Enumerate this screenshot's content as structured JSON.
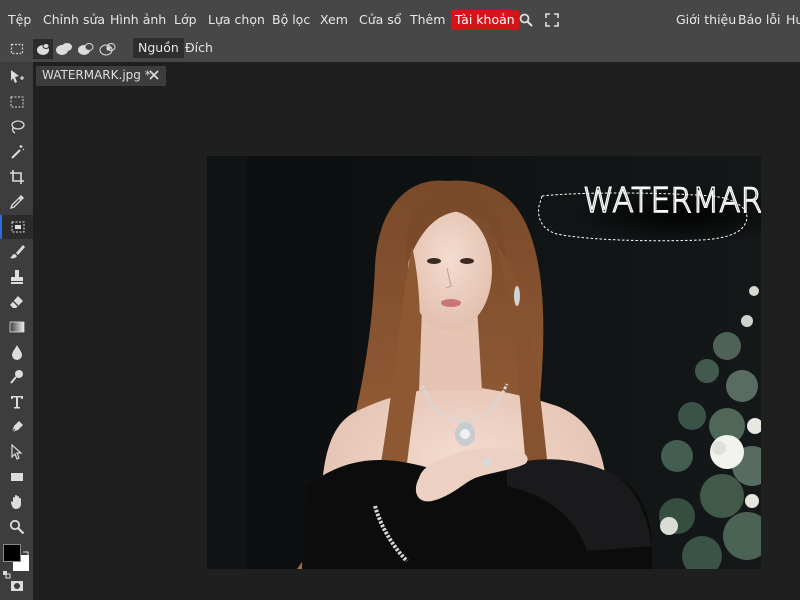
{
  "menu": {
    "items": [
      "Tệp",
      "Chỉnh sửa",
      "Hình ảnh",
      "Lớp",
      "Lựa chọn",
      "Bộ lọc",
      "Xem",
      "Cửa sổ",
      "Thêm",
      "Tài khoản"
    ],
    "right_items": [
      "Giới thiệu",
      "Báo lỗi",
      "Hu"
    ],
    "search_icon": "search-icon",
    "fullscreen_icon": "fullscreen-icon",
    "accent_color": "#d2141b"
  },
  "options": {
    "source_label": "Nguồn",
    "destination_label": "Đích"
  },
  "document": {
    "tab_title": "WATERMARK.jpg *"
  },
  "canvas": {
    "watermark_text": "WATERMARK"
  },
  "toolbox": {
    "selected_tool": "patch-tool",
    "foreground_color": "#000000",
    "background_color": "#ffffff",
    "tools": [
      "move-tool",
      "marquee-tool",
      "lasso-tool",
      "magic-wand-tool",
      "crop-tool",
      "eyedropper-tool",
      "patch-tool",
      "brush-tool",
      "stamp-tool",
      "eraser-tool",
      "gradient-tool",
      "blur-tool",
      "dodge-tool",
      "type-tool",
      "pen-tool",
      "path-select-tool",
      "shape-tool",
      "hand-tool",
      "zoom-tool"
    ]
  }
}
